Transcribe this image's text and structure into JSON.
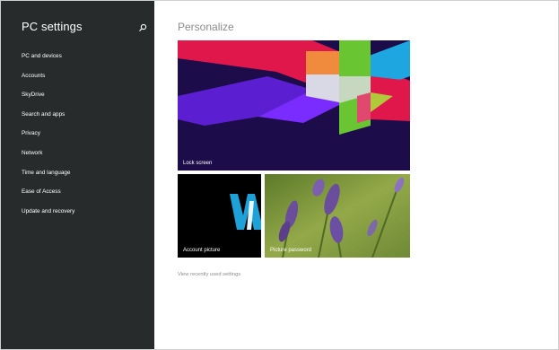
{
  "sidebar": {
    "title": "PC settings",
    "search_icon": "search-icon",
    "items": [
      {
        "label": "PC and devices"
      },
      {
        "label": "Accounts"
      },
      {
        "label": "SkyDrive"
      },
      {
        "label": "Search and apps"
      },
      {
        "label": "Privacy"
      },
      {
        "label": "Network"
      },
      {
        "label": "Time and language"
      },
      {
        "label": "Ease of Access"
      },
      {
        "label": "Update and recovery"
      }
    ]
  },
  "main": {
    "title": "Personalize",
    "tiles": {
      "lock_screen": "Lock screen",
      "account_picture": "Account picture",
      "picture_password": "Picture password"
    },
    "recent_link": "View recently used settings"
  },
  "colors": {
    "sidebar_bg": "#272b2c",
    "main_bg": "#ffffff",
    "title_gray": "#8c8c8c",
    "accent_blue": "#1da1d8"
  }
}
